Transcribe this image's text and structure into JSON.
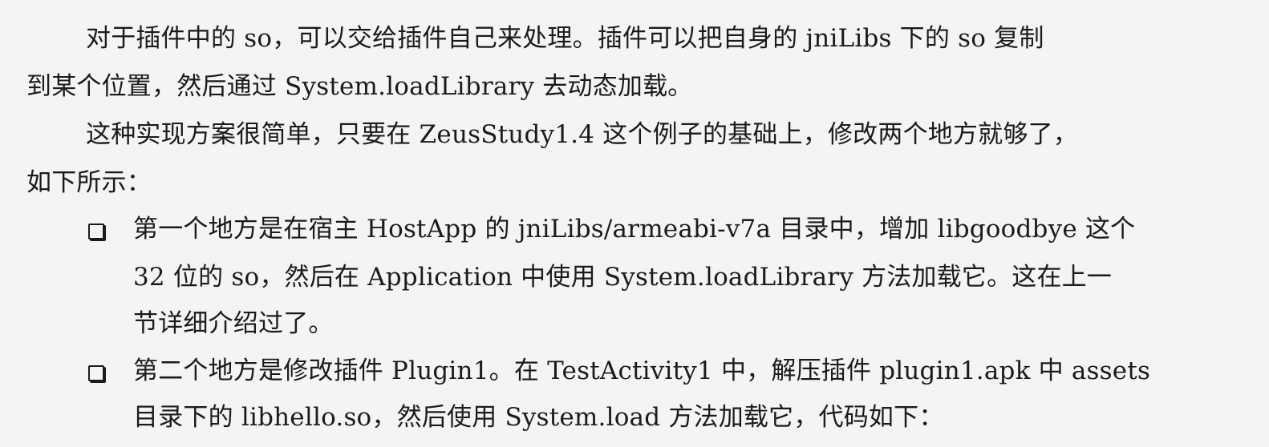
{
  "paragraphs": [
    {
      "line1": "对于插件中的 so，可以交给插件自己来处理。插件可以把自身的 jniLibs 下的 so 复制",
      "line2": "到某个位置，然后通过 System.loadLibrary 去动态加载。"
    },
    {
      "line1": "这种实现方案很简单，只要在 ZeusStudy1.4 这个例子的基础上，修改两个地方就够了，",
      "line2": "如下所示："
    }
  ],
  "list_items": [
    {
      "lines": [
        "第一个地方是在宿主 HostApp 的 jniLibs/armeabi-v7a 目录中，增加 libgoodbye 这个",
        "32 位的 so，然后在 Application 中使用 System.loadLibrary 方法加载它。这在上一",
        "节详细介绍过了。"
      ]
    },
    {
      "lines": [
        "第二个地方是修改插件 Plugin1。在 TestActivity1 中，解压插件 plugin1.apk 中 assets",
        "目录下的 libhello.so，然后使用 System.load 方法加载它，代码如下："
      ]
    }
  ]
}
